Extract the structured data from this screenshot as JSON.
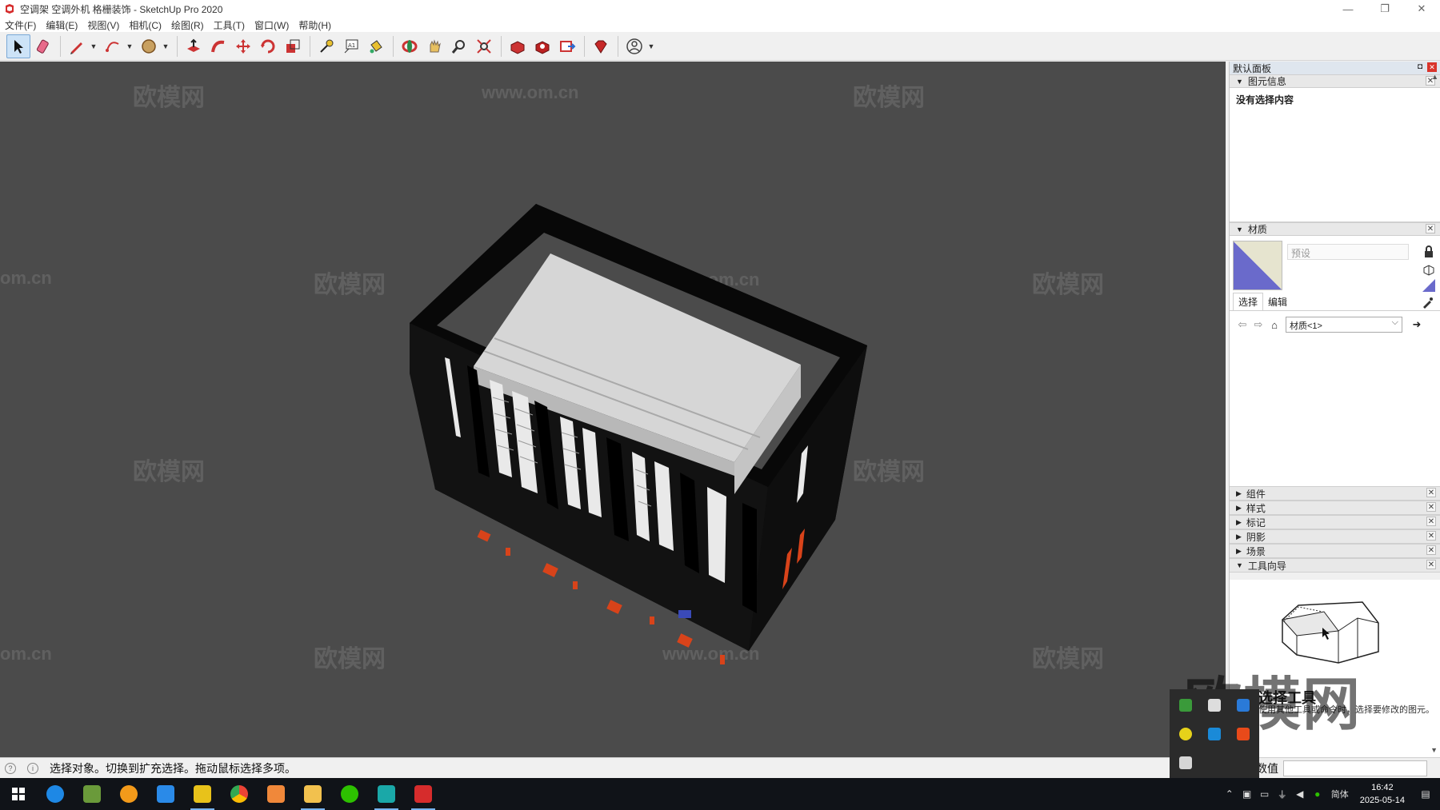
{
  "window": {
    "title": "空调架 空调外机 格栅装饰 - SketchUp Pro 2020",
    "controls": [
      "—",
      "❐",
      "✕"
    ]
  },
  "menu": [
    "文件(F)",
    "编辑(E)",
    "视图(V)",
    "相机(C)",
    "绘图(R)",
    "工具(T)",
    "窗口(W)",
    "帮助(H)"
  ],
  "watermarks": {
    "brand": "欧模网",
    "url": "www.om.cn",
    "partial_url": "om.cn"
  },
  "panel": {
    "title": "默认面板",
    "entity_info": {
      "header": "图元信息",
      "body": "没有选择内容"
    },
    "materials": {
      "header": "材质",
      "name_placeholder": "预设",
      "tabs": [
        "选择",
        "编辑"
      ],
      "selected_tab": "选择",
      "collection": "材质<1>"
    },
    "collapsed_trays": [
      "组件",
      "样式",
      "标记",
      "阴影",
      "场景"
    ],
    "instructor": {
      "header": "工具向导",
      "tool_title": "选择工具",
      "tool_desc": "使用其他工具或命令时，选择要修改的图元。"
    }
  },
  "status": {
    "message": "选择对象。切换到扩充选择。拖动鼠标选择多项。",
    "measure_label": "数值"
  },
  "taskbar": {
    "ime": "简体",
    "time": "16:42",
    "date": "2025-05-14"
  },
  "colors": {
    "viewport_bg": "#4b4b4b",
    "accent": "#78b4f0"
  }
}
